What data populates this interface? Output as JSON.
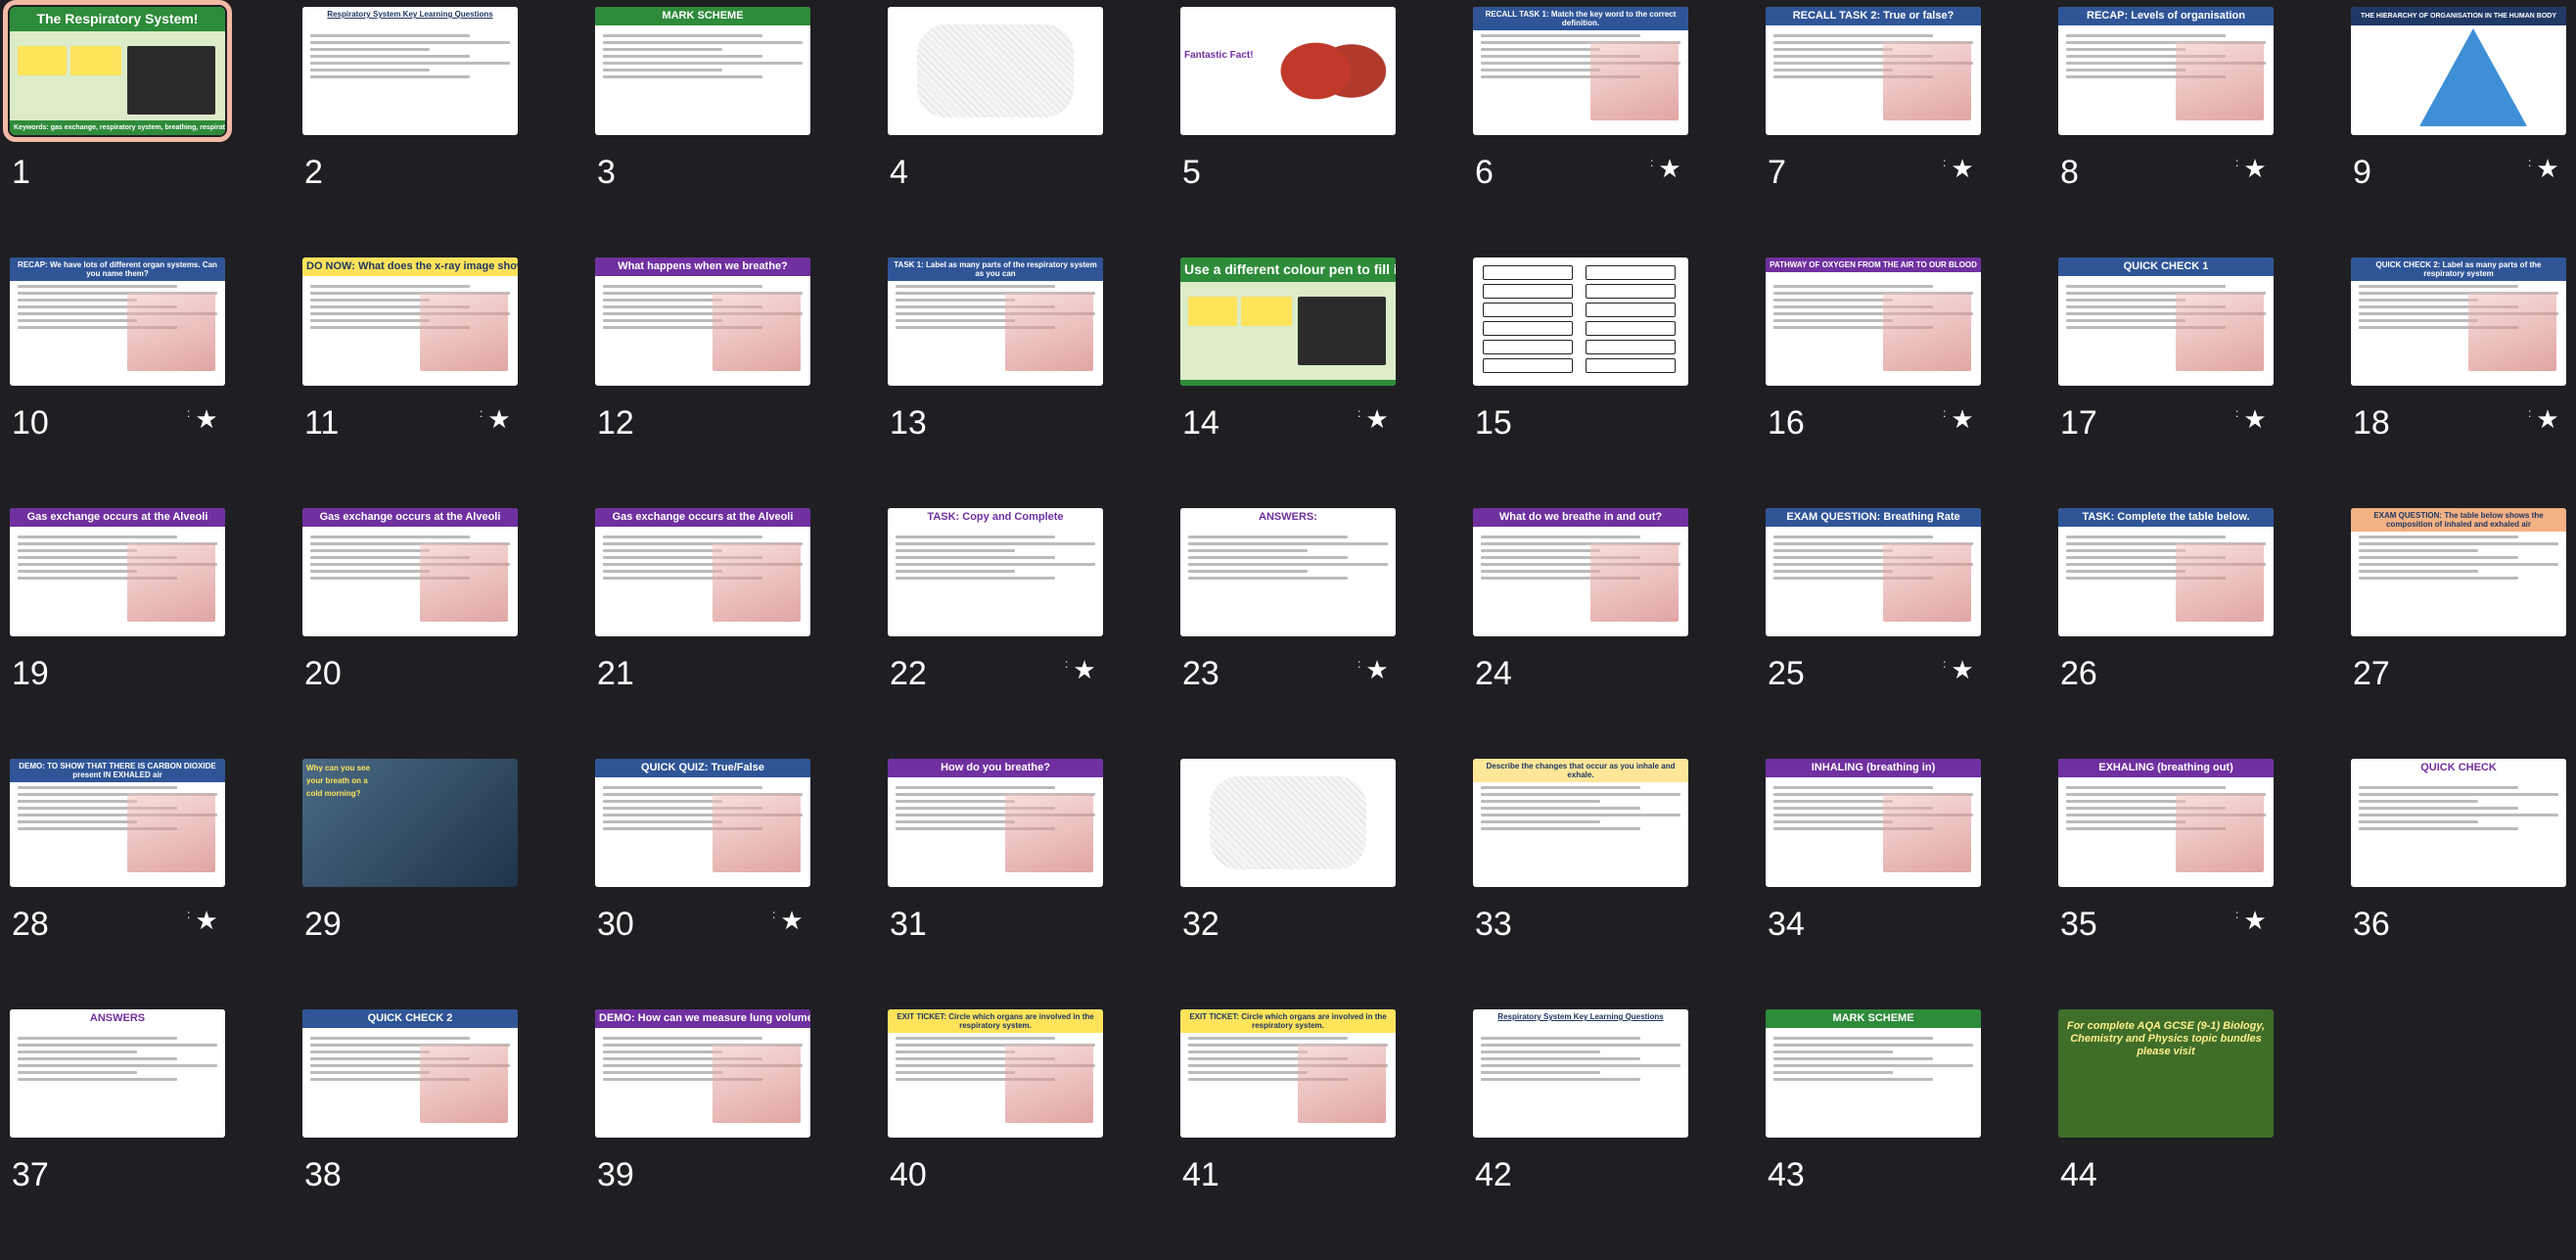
{
  "slides": [
    {
      "n": "1",
      "title": "The Respiratory System!",
      "subtitle": "Keywords: gas exchange, respiratory system, breathing, respiration",
      "theme": "green",
      "starred": false
    },
    {
      "n": "2",
      "title": "Respiratory System Key Learning Questions",
      "theme": "doc",
      "starred": false
    },
    {
      "n": "3",
      "title": "MARK SCHEME",
      "theme": "greenhead",
      "starred": false
    },
    {
      "n": "4",
      "title": "",
      "theme": "sketch",
      "starred": false
    },
    {
      "n": "5",
      "title": "Fantastic Fact!",
      "theme": "lungs",
      "starred": false
    },
    {
      "n": "6",
      "title": "RECALL TASK 1: Match the key word to the correct definition.",
      "theme": "blue",
      "starred": true
    },
    {
      "n": "7",
      "title": "RECALL TASK 2: True or false?",
      "theme": "blue",
      "starred": true
    },
    {
      "n": "8",
      "title": "RECAP: Levels of organisation",
      "theme": "blue",
      "starred": true
    },
    {
      "n": "9",
      "title": "THE HIERARCHY OF ORGANISATION IN THE HUMAN BODY",
      "theme": "pyramid",
      "starred": true
    },
    {
      "n": "10",
      "title": "RECAP: We have lots of different organ systems. Can you name them?",
      "theme": "blue",
      "starred": true
    },
    {
      "n": "11",
      "title": "DO NOW: What does the x-ray image show?",
      "theme": "yellow",
      "starred": true
    },
    {
      "n": "12",
      "title": "What happens when we breathe?",
      "theme": "purple",
      "starred": false
    },
    {
      "n": "13",
      "title": "TASK 1: Label as many parts of the respiratory system as you can",
      "theme": "blue",
      "starred": false
    },
    {
      "n": "14",
      "title": "Use a different colour pen to fill in those you didn't know.",
      "theme": "green",
      "starred": true
    },
    {
      "n": "15",
      "title": "",
      "theme": "boxes",
      "starred": false
    },
    {
      "n": "16",
      "title": "PATHWAY OF OXYGEN FROM THE AIR TO OUR BLOOD",
      "theme": "purple",
      "starred": true
    },
    {
      "n": "17",
      "title": "QUICK CHECK 1",
      "theme": "blue",
      "starred": true
    },
    {
      "n": "18",
      "title": "QUICK CHECK 2: Label as many parts of the respiratory system",
      "theme": "blue",
      "starred": true
    },
    {
      "n": "19",
      "title": "Gas exchange occurs at the Alveoli",
      "theme": "purple",
      "starred": false
    },
    {
      "n": "20",
      "title": "Gas exchange occurs at the Alveoli",
      "theme": "purple",
      "starred": false
    },
    {
      "n": "21",
      "title": "Gas exchange occurs at the Alveoli",
      "theme": "purple",
      "starred": false
    },
    {
      "n": "22",
      "title": "TASK: Copy and Complete",
      "theme": "plain",
      "starred": true
    },
    {
      "n": "23",
      "title": "ANSWERS:",
      "theme": "plain",
      "starred": true
    },
    {
      "n": "24",
      "title": "What do we breathe in and out?",
      "theme": "purple",
      "starred": false
    },
    {
      "n": "25",
      "title": "EXAM QUESTION: Breathing Rate",
      "theme": "blue",
      "starred": true
    },
    {
      "n": "26",
      "title": "TASK: Complete the table below.",
      "theme": "blue",
      "starred": false
    },
    {
      "n": "27",
      "title": "EXAM QUESTION: The table below shows the composition of inhaled and exhaled air",
      "theme": "orange",
      "starred": false
    },
    {
      "n": "28",
      "title": "DEMO: TO SHOW THAT THERE IS CARBON DIOXIDE present IN EXHALED air",
      "theme": "blue",
      "starred": true
    },
    {
      "n": "29",
      "title": "Why can you see your breath on a cold morning?",
      "theme": "window",
      "starred": false
    },
    {
      "n": "30",
      "title": "QUICK QUIZ: True/False",
      "theme": "blue",
      "starred": true
    },
    {
      "n": "31",
      "title": "How do you breathe?",
      "theme": "purple",
      "starred": false
    },
    {
      "n": "32",
      "title": "",
      "theme": "sketch2",
      "starred": false
    },
    {
      "n": "33",
      "title": "Describe the changes that occur as you inhale and exhale.",
      "theme": "yellowbox",
      "starred": false
    },
    {
      "n": "34",
      "title": "INHALING (breathing in)",
      "theme": "purple",
      "starred": false
    },
    {
      "n": "35",
      "title": "EXHALING (breathing out)",
      "theme": "purple",
      "starred": true
    },
    {
      "n": "36",
      "title": "QUICK CHECK",
      "theme": "plain",
      "starred": false
    },
    {
      "n": "37",
      "title": "ANSWERS",
      "theme": "plain",
      "starred": false
    },
    {
      "n": "38",
      "title": "QUICK CHECK 2",
      "theme": "blue",
      "starred": false
    },
    {
      "n": "39",
      "title": "DEMO: How can we measure lung volume?",
      "theme": "purple",
      "starred": false
    },
    {
      "n": "40",
      "title": "EXIT TICKET: Circle which organs are involved in the respiratory system.",
      "theme": "yellow",
      "starred": false
    },
    {
      "n": "41",
      "title": "EXIT TICKET: Circle which organs are involved in the respiratory system.",
      "theme": "yellow",
      "starred": false
    },
    {
      "n": "42",
      "title": "Respiratory System Key Learning Questions",
      "theme": "doc",
      "starred": false
    },
    {
      "n": "43",
      "title": "MARK SCHEME",
      "theme": "greenhead",
      "starred": false
    },
    {
      "n": "44",
      "title": "For complete AQA GCSE (9-1) Biology, Chemistry and Physics topic bundles please visit",
      "theme": "chalk",
      "starred": false
    }
  ],
  "selected_index": 0,
  "colors": {
    "background": "#1f1f23",
    "selection": "#f3b9a6",
    "purple": "#7030a0",
    "blue": "#2f5597",
    "green": "#2e8b3a",
    "yellow": "#ffe35a"
  }
}
